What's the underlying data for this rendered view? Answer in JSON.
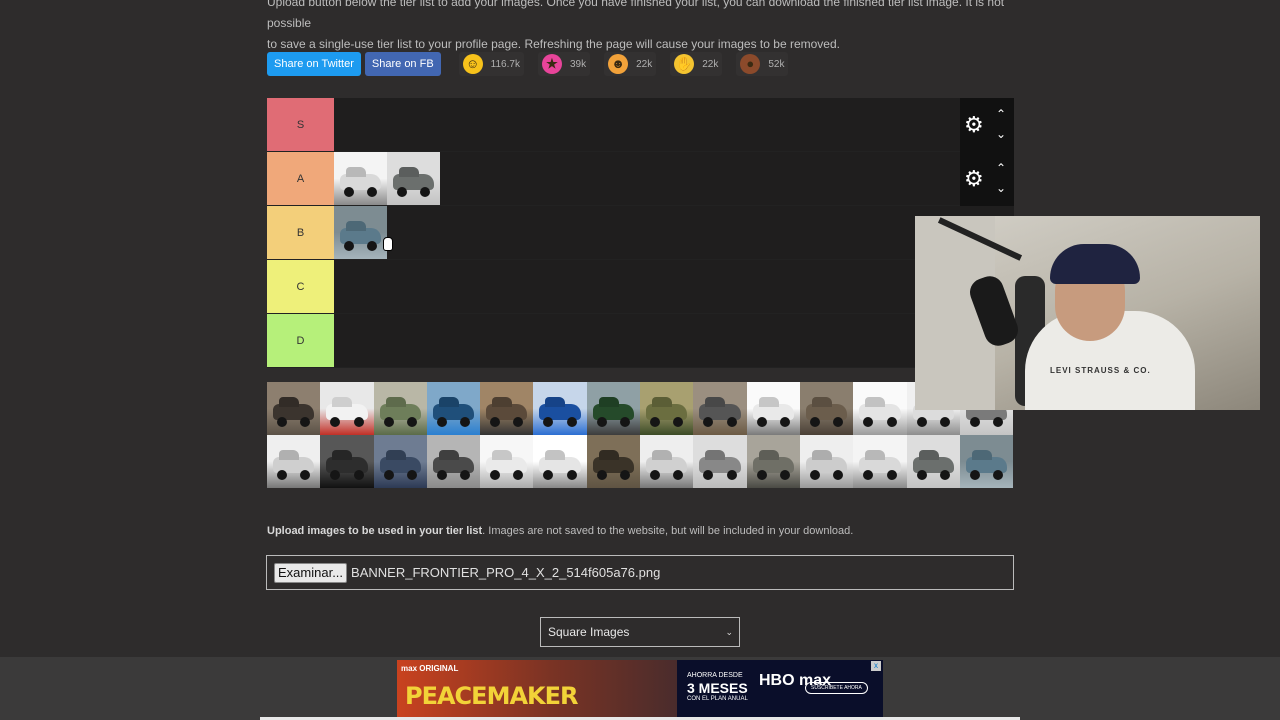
{
  "intro": {
    "line1": "Upload button below the tier list to add your images. Once you have finished your list, you can download the finished tier list image. It is not possible",
    "line2": "to save a single-use tier list to your profile page. Refreshing the page will cause your images to be removed."
  },
  "share": {
    "twitter_label": "Share on Twitter",
    "fb_label": "Share on FB",
    "reactions": [
      {
        "icon": "grinning-face",
        "count": "116.7k",
        "color": "#f7c21b"
      },
      {
        "icon": "star-struck-face",
        "count": "39k",
        "color": "#e8449a"
      },
      {
        "icon": "laughing-face",
        "count": "22k",
        "color": "#f2a23a"
      },
      {
        "icon": "raised-hands",
        "count": "22k",
        "color": "#f4c430"
      },
      {
        "icon": "poop",
        "count": "52k",
        "color": "#8b4a2b"
      }
    ]
  },
  "tiers": [
    {
      "label": "S",
      "color": "#e06c75",
      "items": 0
    },
    {
      "label": "A",
      "color": "#f0a87a",
      "items": 2
    },
    {
      "label": "B",
      "color": "#f3cf7a",
      "items": 1
    },
    {
      "label": "C",
      "color": "#eef07a",
      "items": 0
    },
    {
      "label": "D",
      "color": "#b6f07a",
      "items": 0
    }
  ],
  "pool_count": 28,
  "upload": {
    "bold": "Upload images to be used in your tier list",
    "rest": ". Images are not saved to the website, but will be included in your download.",
    "button_label": "Examinar...",
    "file_name": "BANNER_FRONTIER_PRO_4_X_2_514f605a76.png"
  },
  "image_shape_select": {
    "value": "Square Images"
  },
  "webcam": {
    "shirt_text": "LEVI STRAUSS & CO."
  },
  "ad": {
    "brand_small": "max ORIGINAL",
    "title": "PEACEMAKER",
    "price_line1": "AHORRA DESDE",
    "price_line2": "3 MESES",
    "price_line3": "CON EL PLAN ANUAL",
    "logo": "HBO max",
    "cta": "SUSCRÍBETE AHORA",
    "close": "x"
  },
  "colors": {
    "background": "#2e2c2c",
    "tier_bg": "#1f1e1e",
    "twitter": "#1d9bf0",
    "facebook": "#4267b2"
  }
}
